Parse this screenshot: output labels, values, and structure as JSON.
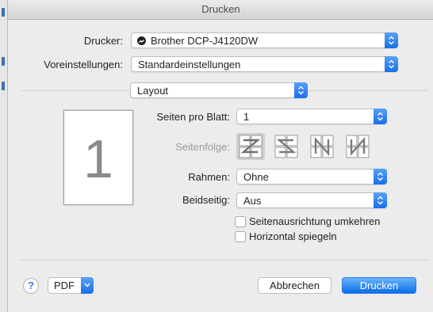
{
  "window": {
    "title": "Drucken"
  },
  "form": {
    "printer_label": "Drucker:",
    "printer_value": "Brother DCP-J4120DW",
    "presets_label": "Voreinstellungen:",
    "presets_value": "Standardeinstellungen",
    "panel_value": "Layout"
  },
  "layout": {
    "preview_number": "1",
    "pages_per_sheet_label": "Seiten pro Blatt:",
    "pages_per_sheet_value": "1",
    "page_order_label": "Seitenfolge:",
    "page_order_icons": [
      "z-order-icon",
      "reverse-s-order-icon",
      "n-reverse-order-icon",
      "n-order-icon"
    ],
    "border_label": "Rahmen:",
    "border_value": "Ohne",
    "two_sided_label": "Beidseitig:",
    "two_sided_value": "Aus",
    "reverse_orientation_label": "Seitenausrichtung umkehren",
    "reverse_orientation_checked": false,
    "flip_horizontal_label": "Horizontal spiegeln",
    "flip_horizontal_checked": false
  },
  "footer": {
    "help_label": "?",
    "pdf_label": "PDF",
    "cancel_label": "Abbrechen",
    "print_label": "Drucken"
  },
  "colors": {
    "accent": "#1a6ee9",
    "dialog_bg": "#ececec",
    "desktop": "#4a6f9c"
  }
}
